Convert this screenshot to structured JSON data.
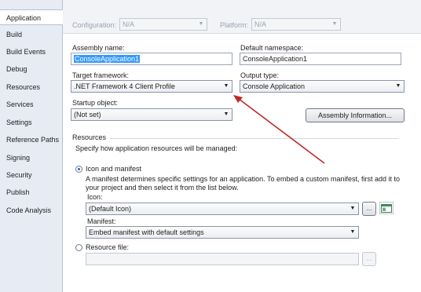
{
  "sidebar": {
    "items": [
      {
        "label": "Application",
        "active": true
      },
      {
        "label": "Build"
      },
      {
        "label": "Build Events"
      },
      {
        "label": "Debug"
      },
      {
        "label": "Resources"
      },
      {
        "label": "Services"
      },
      {
        "label": "Settings"
      },
      {
        "label": "Reference Paths"
      },
      {
        "label": "Signing"
      },
      {
        "label": "Security"
      },
      {
        "label": "Publish"
      },
      {
        "label": "Code Analysis"
      }
    ]
  },
  "top": {
    "configuration_label": "Configuration:",
    "configuration_value": "N/A",
    "platform_label": "Platform:",
    "platform_value": "N/A"
  },
  "app": {
    "assembly_name_label": "Assembly name:",
    "assembly_name_value": "ConsoleApplication1",
    "default_namespace_label": "Default namespace:",
    "default_namespace_value": "ConsoleApplication1",
    "target_framework_label": "Target framework:",
    "target_framework_value": ".NET Framework 4 Client Profile",
    "output_type_label": "Output type:",
    "output_type_value": "Console Application",
    "startup_object_label": "Startup object:",
    "startup_object_value": "(Not set)",
    "assembly_info_button": "Assembly Information..."
  },
  "resources": {
    "title": "Resources",
    "subtitle": "Specify how application resources will be managed:",
    "icon_manifest_label": "Icon and manifest",
    "icon_manifest_desc": "A manifest determines specific settings for an application. To embed a custom manifest, first add it to your project and then select it from the list below.",
    "icon_label": "Icon:",
    "icon_value": "(Default Icon)",
    "browse_label": "...",
    "manifest_label": "Manifest:",
    "manifest_value": "Embed manifest with default settings",
    "resource_file_label": "Resource file:",
    "resource_file_value": "",
    "resource_browse_label": "..."
  },
  "colors": {
    "annotation_arrow": "#c0282a",
    "selection": "#3399ff"
  }
}
